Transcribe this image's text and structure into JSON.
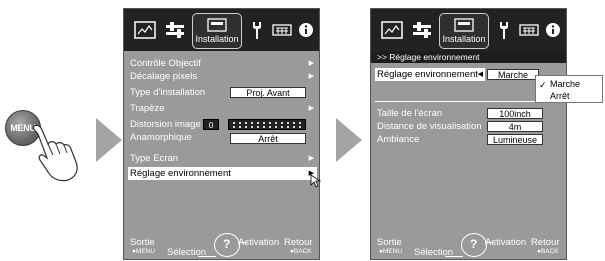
{
  "menu_button": {
    "label": "MENU"
  },
  "tabs": {
    "active_label": "Installation"
  },
  "screen1": {
    "items": [
      {
        "label": "Contrôle Objectif"
      },
      {
        "label": "Décalage pixels"
      },
      {
        "label": "Type d'installation",
        "value": "Proj. Avant"
      },
      {
        "label": "Trapèze"
      },
      {
        "label": "Distorsion image",
        "value": "0"
      },
      {
        "label": "Anamorphique",
        "value": "Arrêt"
      },
      {
        "label": "Type Ecran"
      },
      {
        "label": "Réglage environnement"
      }
    ]
  },
  "screen2": {
    "breadcrumb": ">> Réglage environnement",
    "items": [
      {
        "label": "Réglage environnement",
        "value": "Marche"
      },
      {
        "label": "Taille de l'écran",
        "value": "100inch"
      },
      {
        "label": "Distance de visualisation",
        "value": "4m"
      },
      {
        "label": "Ambiance",
        "value": "Lumineuse"
      }
    ],
    "dropdown": [
      "Marche",
      "Arrêt"
    ]
  },
  "footer": {
    "exit": "Sortie",
    "menu_key": "●MENU",
    "selection": "Sélection",
    "activation": "Activation",
    "back": "Retour",
    "back_key": "●BACK"
  },
  "colors": {
    "osd_bg": "#9a9a9a",
    "topbar": "#222222",
    "highlight": "#ffffff",
    "arrow": "#a4a4a4"
  }
}
